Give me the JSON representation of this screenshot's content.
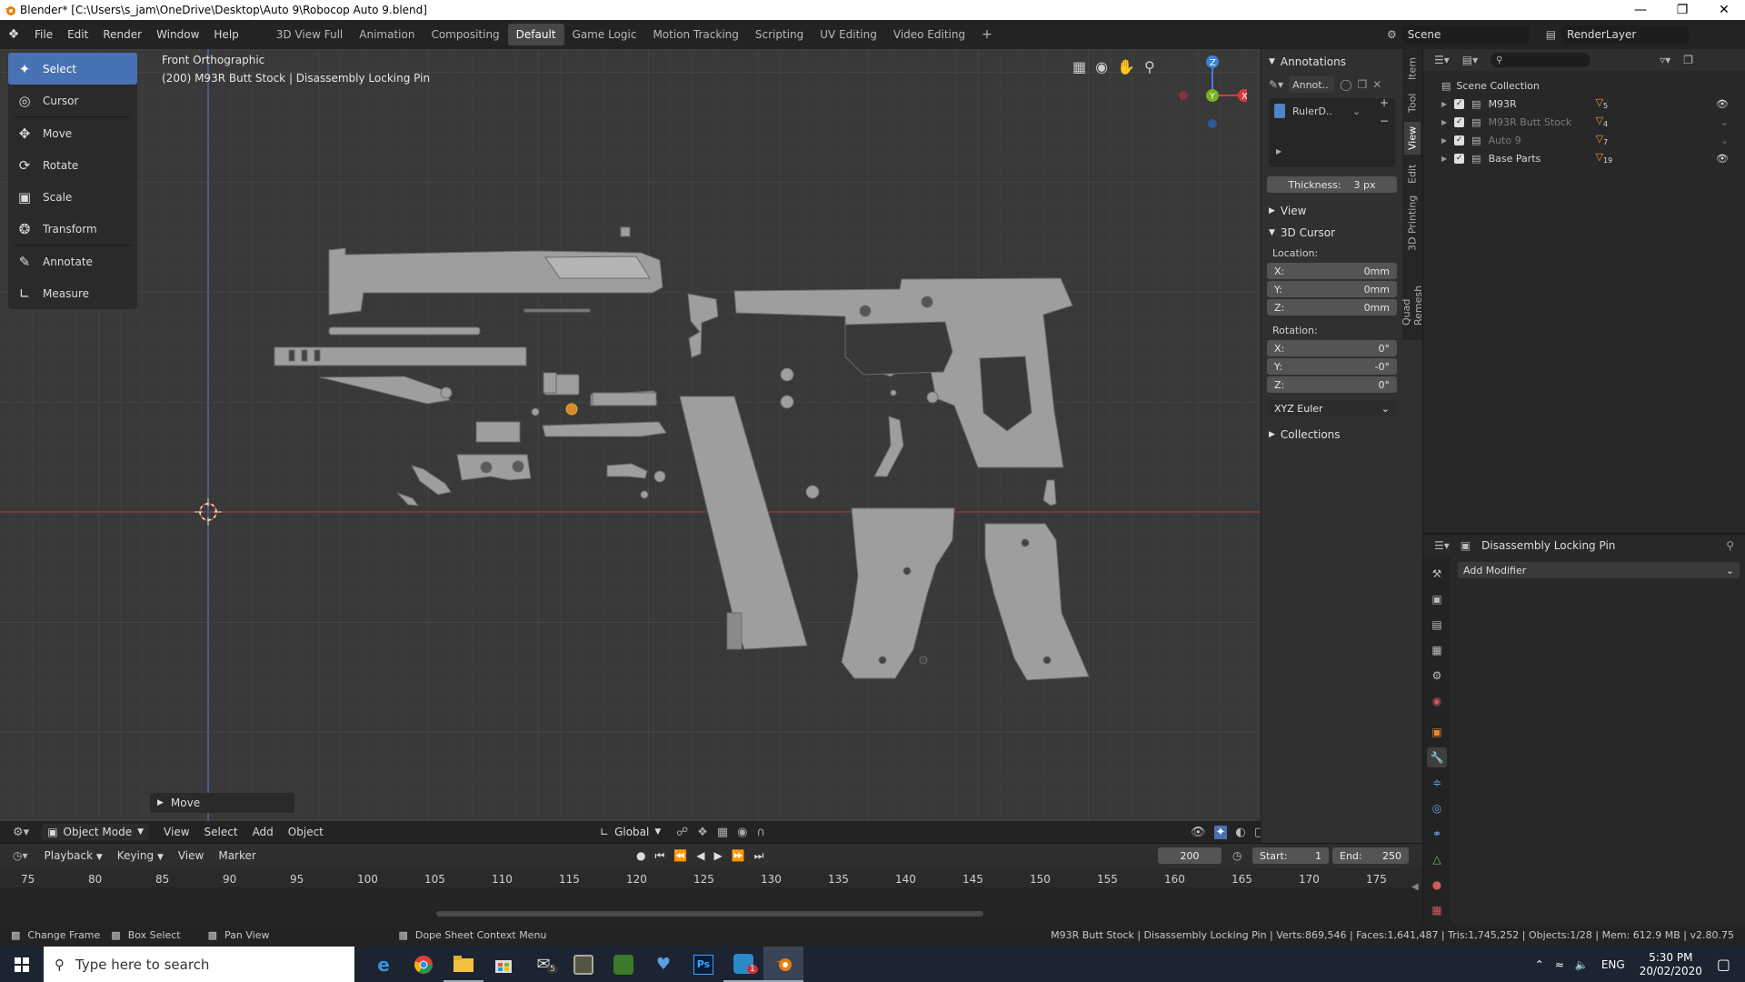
{
  "window": {
    "title": "Blender* [C:\\Users\\s_jam\\OneDrive\\Desktop\\Auto 9\\Robocop Auto 9.blend]"
  },
  "menu": [
    "File",
    "Edit",
    "Render",
    "Window",
    "Help"
  ],
  "workspaces": [
    "3D View Full",
    "Animation",
    "Compositing",
    "Default",
    "Game Logic",
    "Motion Tracking",
    "Scripting",
    "UV Editing",
    "Video Editing"
  ],
  "active_workspace": "Default",
  "scene": {
    "name": "Scene",
    "render_layer": "RenderLayer"
  },
  "viewport": {
    "view_name": "Front Orthographic",
    "context": "(200) M93R Butt Stock | Disassembly Locking Pin",
    "last_op": "Move"
  },
  "tools": [
    "Select",
    "Cursor",
    "Move",
    "Rotate",
    "Scale",
    "Transform",
    "Annotate",
    "Measure"
  ],
  "npanel": {
    "annotations_label": "Annotations",
    "annot_name": "Annot..",
    "layer_name": "RulerD..",
    "thickness_label": "Thickness:",
    "thickness_value": "3 px",
    "view_label": "View",
    "cursor_label": "3D Cursor",
    "location_label": "Location:",
    "loc": [
      {
        "axis": "X:",
        "value": "0mm"
      },
      {
        "axis": "Y:",
        "value": "0mm"
      },
      {
        "axis": "Z:",
        "value": "0mm"
      }
    ],
    "rotation_label": "Rotation:",
    "rot": [
      {
        "axis": "X:",
        "value": "0°"
      },
      {
        "axis": "Y:",
        "value": "-0°"
      },
      {
        "axis": "Z:",
        "value": "0°"
      }
    ],
    "rot_mode": "XYZ Euler",
    "collections_label": "Collections"
  },
  "npanel_tabs": [
    "Item",
    "Tool",
    "View",
    "Edit",
    "3D Printing",
    "Quad Remesh"
  ],
  "npanel_active_tab": "View",
  "outliner": {
    "root": "Scene Collection",
    "items": [
      {
        "name": "M93R",
        "count": "5",
        "dim": false,
        "visible": true
      },
      {
        "name": "M93R Butt Stock",
        "count": "4",
        "dim": true,
        "visible": false
      },
      {
        "name": "Auto 9",
        "count": "7",
        "dim": true,
        "visible": false
      },
      {
        "name": "Base Parts",
        "count": "19",
        "dim": false,
        "visible": true
      }
    ]
  },
  "properties": {
    "object_name": "Disassembly Locking Pin",
    "add_modifier": "Add Modifier"
  },
  "header3d": {
    "mode": "Object Mode",
    "menus": [
      "View",
      "Select",
      "Add",
      "Object"
    ],
    "orientation": "Global"
  },
  "timeline": {
    "menus": [
      "Playback",
      "Keying",
      "View",
      "Marker"
    ],
    "current_frame": "200",
    "start_label": "Start:",
    "start": "1",
    "end_label": "End:",
    "end": "250",
    "ticks": [
      "75",
      "80",
      "85",
      "90",
      "95",
      "100",
      "105",
      "110",
      "115",
      "120",
      "125",
      "130",
      "135",
      "140",
      "145",
      "150",
      "155",
      "160",
      "165",
      "170",
      "175"
    ]
  },
  "status": {
    "left": [
      "Change Frame",
      "Box Select",
      "Pan View"
    ],
    "mid": "Dope Sheet Context Menu",
    "stats": "M93R Butt Stock | Disassembly Locking Pin | Verts:869,546 | Faces:1,641,487 | Tris:1,745,252 | Objects:1/28 | Mem: 612.9 MB | v2.80.75"
  },
  "taskbar": {
    "search_placeholder": "Type here to search",
    "lang": "ENG",
    "time": "5:30 PM",
    "date": "20/02/2020",
    "mail_badge": "5",
    "app_badge": "1"
  },
  "colors": {
    "accent": "#4772b3",
    "x_axis": "#d8383e",
    "y_axis": "#78b020",
    "z_axis": "#3c82d8",
    "mesh": "#9c9c9c"
  }
}
